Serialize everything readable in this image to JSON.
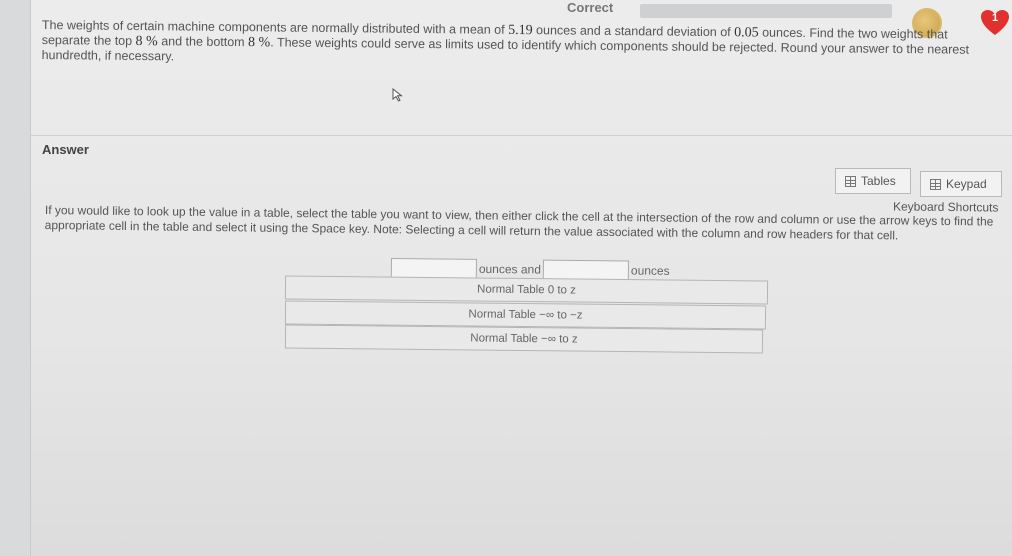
{
  "header": {
    "status_label": "Correct",
    "progress_fraction": 0.0,
    "lives_count": "1"
  },
  "question": {
    "part1": "The weights of certain machine components are normally distributed with a mean of ",
    "mean": "5.19",
    "part2": " ounces and a standard deviation of ",
    "sd": "0.05",
    "part3": " ounces. Find the two weights that separate the top ",
    "top_pct": "8 %",
    "part4": " and the bottom ",
    "bottom_pct": "8 %",
    "part5": ". These weights could serve as limits used to identify which components should be rejected. Round your answer to the nearest hundredth, if necessary."
  },
  "answer": {
    "label": "Answer",
    "tables_label": "Tables",
    "keypad_label": "Keypad",
    "keyboard_shortcuts": "Keyboard Shortcuts",
    "instructions": "If you would like to look up the value in a table, select the table you want to view, then either click the cell at the intersection of the row and column or use the arrow keys to find the appropriate cell in the table and select it using the Space key. Note: Selecting a cell will return the value associated with the column and row headers for that cell.",
    "input1_value": "",
    "unit1": "ounces and",
    "input2_value": "",
    "unit2": "ounces",
    "tables": [
      "Normal Table 0 to z",
      "Normal Table −∞ to −z",
      "Normal Table −∞ to z"
    ]
  },
  "colors": {
    "heart": "#e0312f",
    "coin": "#d3ad5c"
  }
}
